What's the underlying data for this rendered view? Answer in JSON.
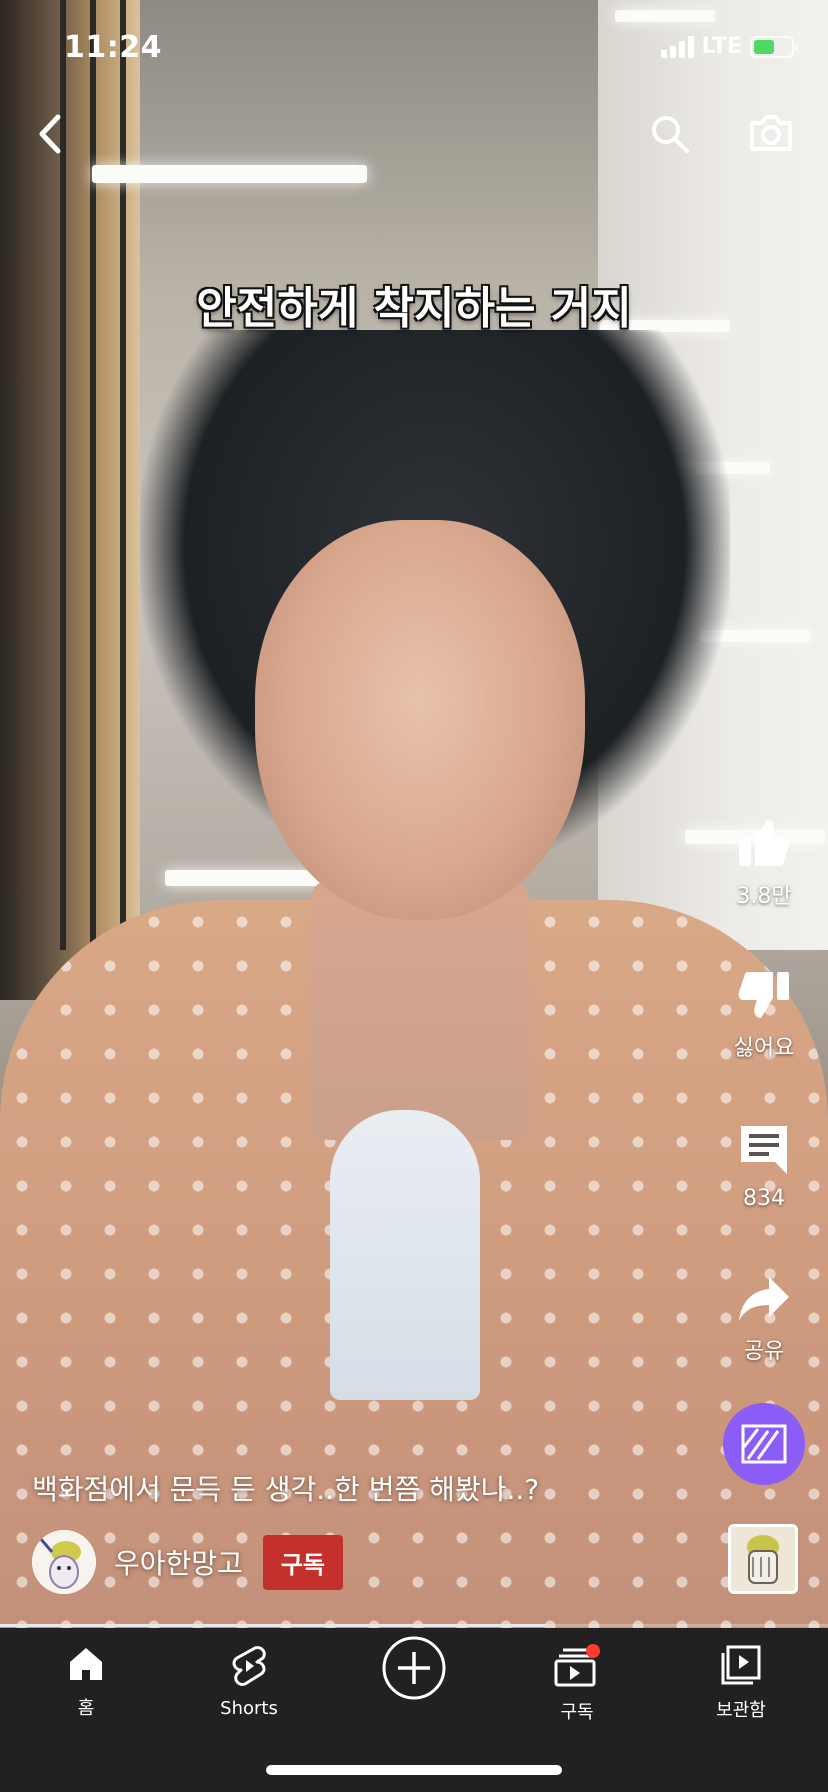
{
  "status_bar": {
    "time": "11:24",
    "network": "LTE",
    "battery_level": 0.6
  },
  "top_bar": {
    "back_icon": "chevron-left-icon",
    "search_icon": "search-icon",
    "camera_icon": "camera-icon"
  },
  "video": {
    "caption": "안전하게 착지하는 거지",
    "title": "백화점에서 문득 든 생각..한 번쯤 해봤나..?",
    "progress": 0.66
  },
  "channel": {
    "name": "우아한망고",
    "subscribe_label": "구독"
  },
  "actions": {
    "like_count": "3.8만",
    "dislike_label": "싫어요",
    "comment_count": "834",
    "share_label": "공유"
  },
  "bottom_nav": {
    "items": [
      {
        "label": "홈",
        "icon": "home-icon"
      },
      {
        "label": "Shorts",
        "icon": "shorts-icon"
      },
      {
        "label": "",
        "icon": "create-icon"
      },
      {
        "label": "구독",
        "icon": "subscriptions-icon"
      },
      {
        "label": "보관함",
        "icon": "library-icon"
      }
    ]
  },
  "colors": {
    "subscribe": "#c4302b",
    "remix": "#8b5cf6",
    "nav_background": "#212121",
    "notification_dot": "#ff3b30"
  }
}
